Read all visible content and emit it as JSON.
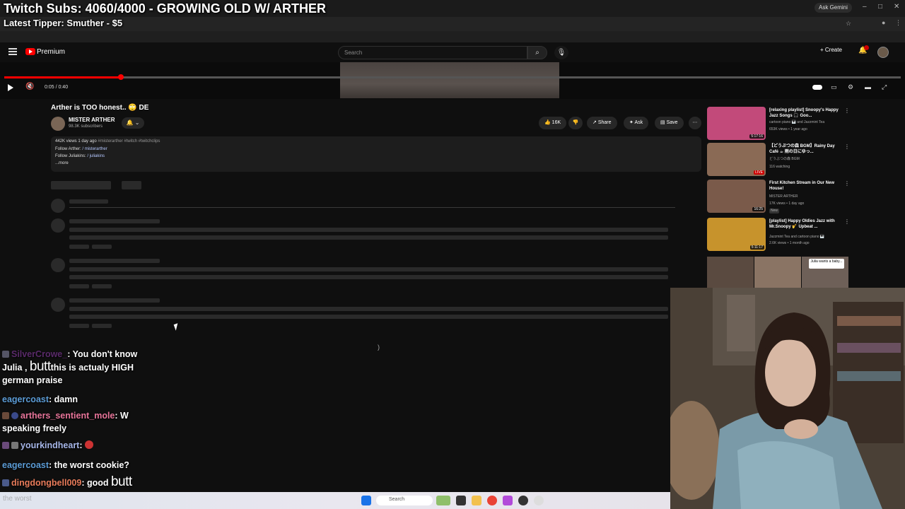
{
  "overlay": {
    "title": "Twitch Subs: 4060/4000 - GROWING OLD W/ ARTHER",
    "tipper": "Latest Tipper: Smuther - $5"
  },
  "browser": {
    "gemini_label": "Ask Gemini"
  },
  "masthead": {
    "brand": "Premium",
    "search_placeholder": "Search",
    "create_label": "Create",
    "notification_count": "4"
  },
  "player": {
    "time": "0:05 / 0:40",
    "progress_fraction": 0.13
  },
  "video": {
    "title": "Arther is TOO honest.. 🙄 DE",
    "channel_name": "MISTER ARTHER",
    "subscribers": "98.3K subscribers",
    "likes": "16K",
    "share_label": "Share",
    "ask_label": "Ask",
    "save_label": "Save",
    "desc_stats": "442K views 1 day ago",
    "desc_tags": "#misterarther #twitch #twitchclips",
    "desc_follow1_label": "Follow Arther:",
    "desc_follow1_link": "/ misterarther",
    "desc_follow2_label": "Follow Juliakins:",
    "desc_follow2_link": "/ juliakins",
    "desc_more": "...more"
  },
  "related": [
    {
      "title": "[relaxing playlist] Snoopy's Happy Jazz Songs 🎧 Goo...",
      "channel": "cartoon piano 🎹 and Jazzmint Tea",
      "stats": "653K views • 1 year ago",
      "duration": "5:17:16",
      "thumb_color": "#c24a7a"
    },
    {
      "title": "【どうぶつの森 BGM】Rainy Day Café ☕ 雨の日にゆっ...",
      "channel": "どうぶつの森 BGM",
      "stats": "116 watching",
      "duration": "LIVE",
      "thumb_color": "#8a6a55"
    },
    {
      "title": "First Kitchen Stream in Our New House!",
      "channel": "MISTER ARTHER",
      "stats": "17K views • 1 day ago",
      "badge": "New",
      "duration": "16:25",
      "thumb_color": "#7a5a4a"
    },
    {
      "title": "[playlist] Happy Oldies Jazz with Mr.Snoopy 🎷 Upbeat ...",
      "channel": "Jazzmint Tea and cartoon piano 🎹",
      "stats": "2.6K views • 1 month ago",
      "duration": "5:11:17",
      "thumb_color": "#c7932c"
    }
  ],
  "shorts_caption": "Julia wants a baby...",
  "chat": [
    {
      "user": "SilverCrowe_",
      "user_color": "#5a2a6a",
      "text_parts": [
        "You don't know",
        "Julia ,",
        "butt",
        "this is actualy HIGH",
        "german praise"
      ]
    },
    {
      "user": "eagercoast",
      "user_color": "#5b9bd5",
      "text": "damn"
    },
    {
      "user": "arthers_sentient_mole",
      "user_color": "#e8759a",
      "text": "W speaking freely"
    },
    {
      "user": "yourkindheart",
      "user_color": "#a6b6e8",
      "text": ""
    },
    {
      "user": "eagercoast",
      "user_color": "#5b9bd5",
      "text": "the worst cookie?"
    },
    {
      "user": "dingdongbell009",
      "user_color": "#e87b5a",
      "text": "good",
      "emote": "butt"
    }
  ],
  "taskbar": {
    "search_label": "Search",
    "ghost_text": "the worst"
  }
}
